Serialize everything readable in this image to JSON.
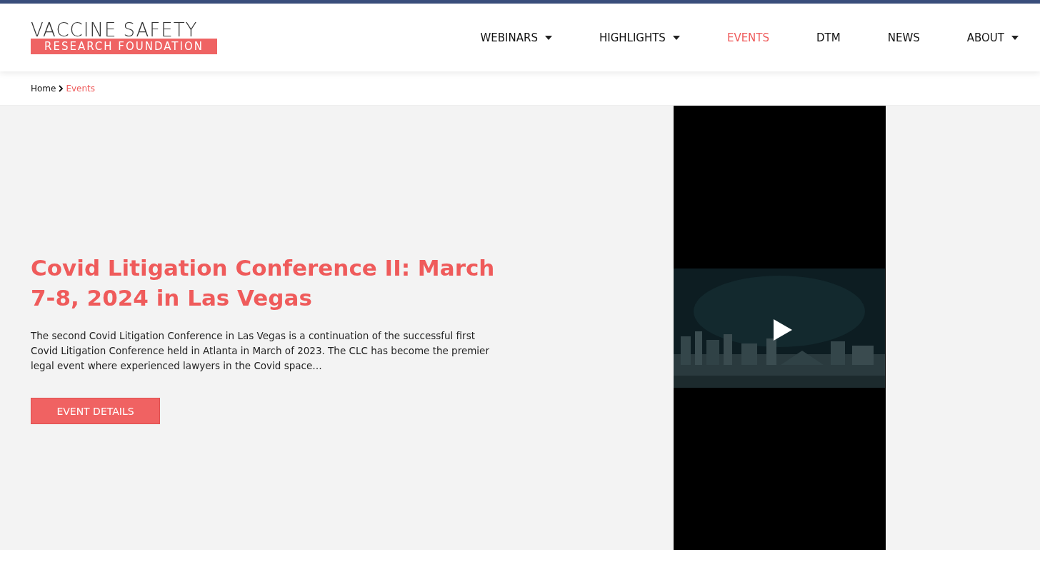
{
  "logo": {
    "line_1": "VACCINE SAFETY",
    "line_2": "RESEARCH FOUNDATION"
  },
  "nav": [
    {
      "label": "WEBINARS",
      "selected": false,
      "dropdown": true
    },
    {
      "label": "HIGHLIGHTS",
      "selected": false,
      "dropdown": true
    },
    {
      "label": "EVENTS",
      "selected": true,
      "dropdown": false
    },
    {
      "label": "DTM",
      "selected": false,
      "dropdown": false
    },
    {
      "label": "NEWS",
      "selected": false,
      "dropdown": false
    },
    {
      "label": "ABOUT",
      "selected": false,
      "dropdown": true
    }
  ],
  "breadcrumb": {
    "home": "Home",
    "current": "Events"
  },
  "event": {
    "title": "Covid Litigation Conference II: March 7-8, 2024 in Las Vegas",
    "summary": "The second Covid Litigation Conference in Las Vegas is a continuation of the successful first Covid Litigation Conference held in Atlanta in March of 2023. The CLC has become the premier legal event where experienced lawyers in the Covid space…",
    "button": "EVENT DETAILS"
  }
}
